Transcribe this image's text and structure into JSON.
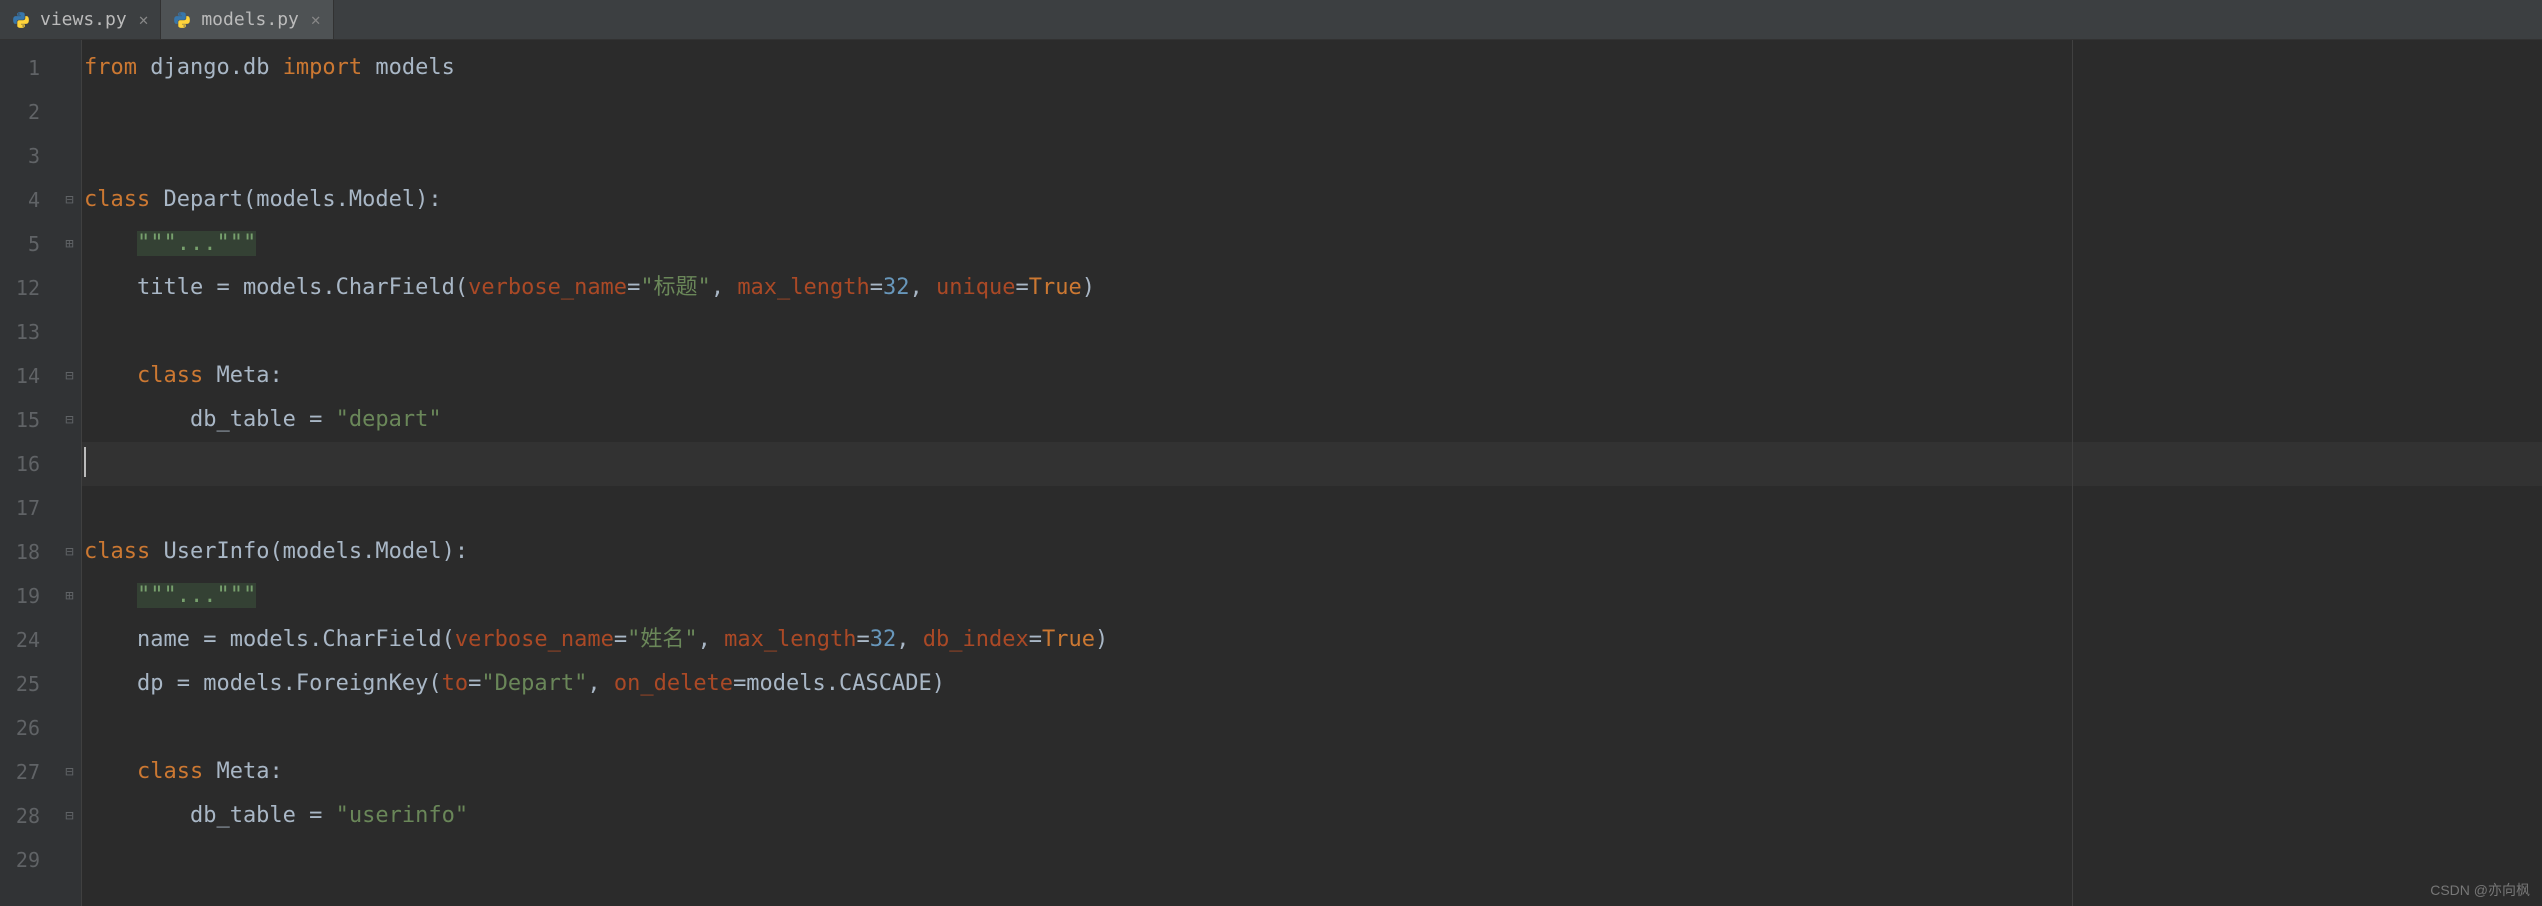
{
  "tabs": [
    {
      "label": "views.py",
      "active": false
    },
    {
      "label": "models.py",
      "active": true
    }
  ],
  "lineNumbers": [
    "1",
    "2",
    "3",
    "4",
    "5",
    "12",
    "13",
    "14",
    "15",
    "16",
    "17",
    "18",
    "19",
    "24",
    "25",
    "26",
    "27",
    "28",
    "29"
  ],
  "foldMarkers": [
    "",
    "",
    "",
    "minus",
    "plus",
    "",
    "",
    "minus",
    "minus",
    "",
    "",
    "minus",
    "plus",
    "",
    "",
    "",
    "minus",
    "minus",
    ""
  ],
  "code": {
    "l1_from": "from",
    "l1_mod": " django.db ",
    "l1_import": "import",
    "l1_models": " models",
    "l4_class": "class",
    "l4_name": " Depart(models.Model):",
    "l5_doc": "\"\"\"...\"\"\"",
    "l12_a": "    title = models.CharField(",
    "l12_p1": "verbose_name",
    "l12_eq1": "=",
    "l12_s1": "\"标题\"",
    "l12_c1": ", ",
    "l12_p2": "max_length",
    "l12_eq2": "=",
    "l12_n1": "32",
    "l12_c2": ", ",
    "l12_p3": "unique",
    "l12_eq3": "=",
    "l12_true": "True",
    "l12_end": ")",
    "l14_class": "class",
    "l14_meta": " Meta:",
    "l15_a": "        db_table = ",
    "l15_s": "\"depart\"",
    "l18_class": "class",
    "l18_name": " UserInfo(models.Model):",
    "l19_doc": "\"\"\"...\"\"\"",
    "l24_a": "    name = models.CharField(",
    "l24_p1": "verbose_name",
    "l24_eq1": "=",
    "l24_s1": "\"姓名\"",
    "l24_c1": ", ",
    "l24_p2": "max_length",
    "l24_eq2": "=",
    "l24_n1": "32",
    "l24_c2": ", ",
    "l24_p3": "db_index",
    "l24_eq3": "=",
    "l24_true": "True",
    "l24_end": ")",
    "l25_a": "    dp = models.ForeignKey(",
    "l25_p1": "to",
    "l25_eq1": "=",
    "l25_s1": "\"Depart\"",
    "l25_c1": ", ",
    "l25_p2": "on_delete",
    "l25_eq2": "=models.CASCADE)",
    "l27_class": "class",
    "l27_meta": " Meta:",
    "l28_a": "        db_table = ",
    "l28_s": "\"userinfo\""
  },
  "watermark": "CSDN @亦向枫"
}
